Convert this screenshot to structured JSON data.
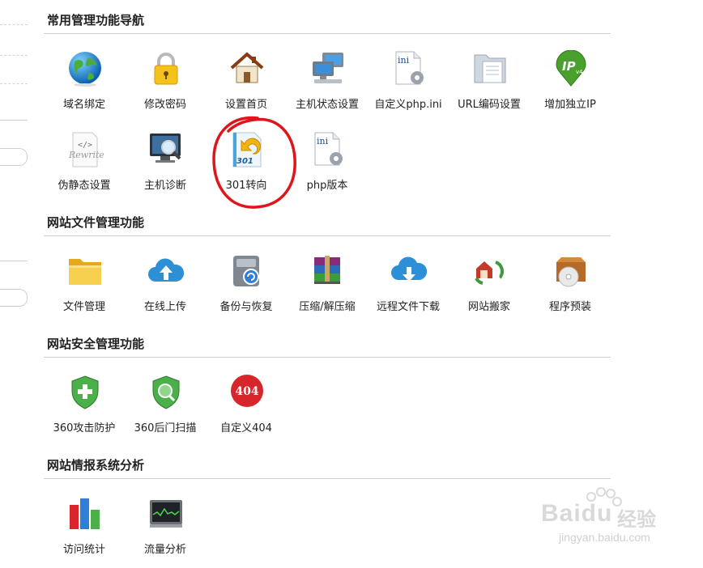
{
  "sections": [
    {
      "title": "常用管理功能导航",
      "items": [
        {
          "label": "域名绑定",
          "icon": "globe-icon"
        },
        {
          "label": "修改密码",
          "icon": "padlock-icon"
        },
        {
          "label": "设置首页",
          "icon": "house-icon"
        },
        {
          "label": "主机状态设置",
          "icon": "computers-icon"
        },
        {
          "label": "自定义php.ini",
          "icon": "ini-file-gear-icon"
        },
        {
          "label": "URL编码设置",
          "icon": "folder-document-icon"
        },
        {
          "label": "增加独立IP",
          "icon": "ip-pin-icon"
        },
        {
          "label": "伪静态设置",
          "icon": "rewrite-icon"
        },
        {
          "label": "主机诊断",
          "icon": "monitor-magnifier-icon"
        },
        {
          "label": "301转向",
          "icon": "redirect-301-icon"
        },
        {
          "label": "php版本",
          "icon": "ini-file-gear-icon"
        }
      ]
    },
    {
      "title": "网站文件管理功能",
      "items": [
        {
          "label": "文件管理",
          "icon": "folder-icon"
        },
        {
          "label": "在线上传",
          "icon": "cloud-upload-icon"
        },
        {
          "label": "备份与恢复",
          "icon": "disk-backup-icon"
        },
        {
          "label": "压缩/解压缩",
          "icon": "archive-books-icon"
        },
        {
          "label": "远程文件下载",
          "icon": "cloud-download-icon"
        },
        {
          "label": "网站搬家",
          "icon": "house-move-icon"
        },
        {
          "label": "程序预装",
          "icon": "box-cd-icon"
        }
      ]
    },
    {
      "title": "网站安全管理功能",
      "items": [
        {
          "label": "360攻击防护",
          "icon": "shield-plus-icon"
        },
        {
          "label": "360后门扫描",
          "icon": "shield-scan-icon"
        },
        {
          "label": "自定义404",
          "icon": "circle-404-icon",
          "badge": "404"
        }
      ]
    },
    {
      "title": "网站情报系统分析",
      "items": [
        {
          "label": "访问统计",
          "icon": "bar-chart-icon"
        },
        {
          "label": "流量分析",
          "icon": "monitor-graph-icon"
        }
      ]
    }
  ],
  "icon_text": {
    "ini": "ini",
    "rewrite_tag": "</>",
    "rewrite": "Rewrite",
    "ip": "IP",
    "ip_ver": "v4",
    "code301": "301"
  },
  "watermark": {
    "brand": "Baidu",
    "suffix": "经验",
    "url": "jingyan.baidu.com"
  },
  "colors": {
    "annotation": "#e0151b",
    "divider": "#cfcfcf",
    "title": "#222222"
  }
}
